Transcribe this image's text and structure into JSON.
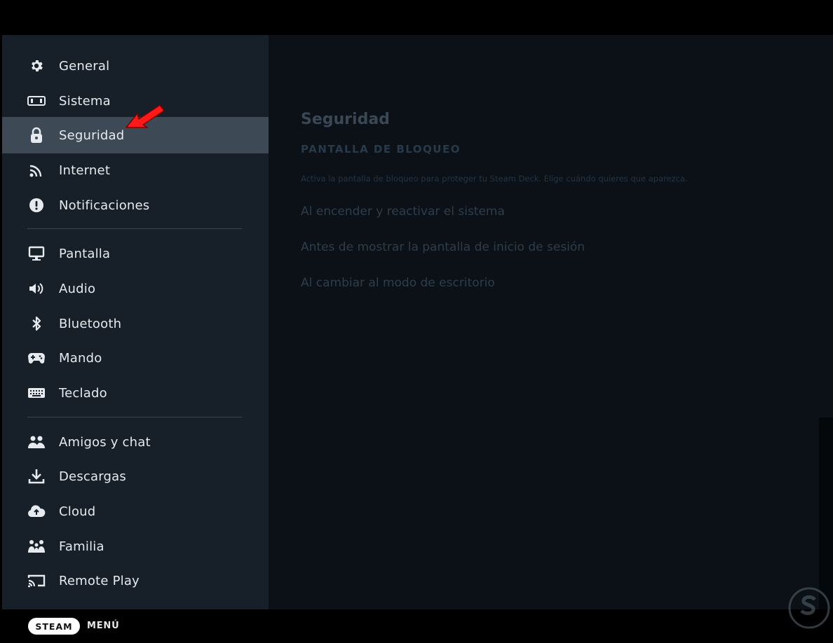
{
  "sidebar": {
    "items": [
      {
        "label": "General",
        "icon": "gear-icon"
      },
      {
        "label": "Sistema",
        "icon": "system-icon"
      },
      {
        "label": "Seguridad",
        "icon": "lock-icon",
        "active": true
      },
      {
        "label": "Internet",
        "icon": "wifi-icon"
      },
      {
        "label": "Notificaciones",
        "icon": "alert-icon"
      },
      {
        "label": "Pantalla",
        "icon": "monitor-icon"
      },
      {
        "label": "Audio",
        "icon": "speaker-icon"
      },
      {
        "label": "Bluetooth",
        "icon": "bluetooth-icon"
      },
      {
        "label": "Mando",
        "icon": "gamepad-icon"
      },
      {
        "label": "Teclado",
        "icon": "keyboard-icon"
      },
      {
        "label": "Amigos y chat",
        "icon": "friends-icon"
      },
      {
        "label": "Descargas",
        "icon": "download-icon"
      },
      {
        "label": "Cloud",
        "icon": "cloud-icon"
      },
      {
        "label": "Familia",
        "icon": "family-icon"
      },
      {
        "label": "Remote Play",
        "icon": "cast-icon"
      }
    ]
  },
  "content": {
    "title": "Seguridad",
    "subtitle": "PANTALLA DE BLOQUEO",
    "description": "Activa la pantalla de bloqueo para proteger tu Steam Deck. Elige cuándo quieres que aparezca.",
    "options": [
      "Al encender y reactivar el sistema",
      "Antes de mostrar la pantalla de inicio de sesión",
      "Al cambiar al modo de escritorio"
    ]
  },
  "footer": {
    "steam_label": "STEAM",
    "menu_label": "MENÚ"
  },
  "colors": {
    "sidebar_bg": "#172029",
    "active_bg": "#3d4a55",
    "content_bg": "#0b1117",
    "annotation_arrow": "#ff1a1a"
  }
}
